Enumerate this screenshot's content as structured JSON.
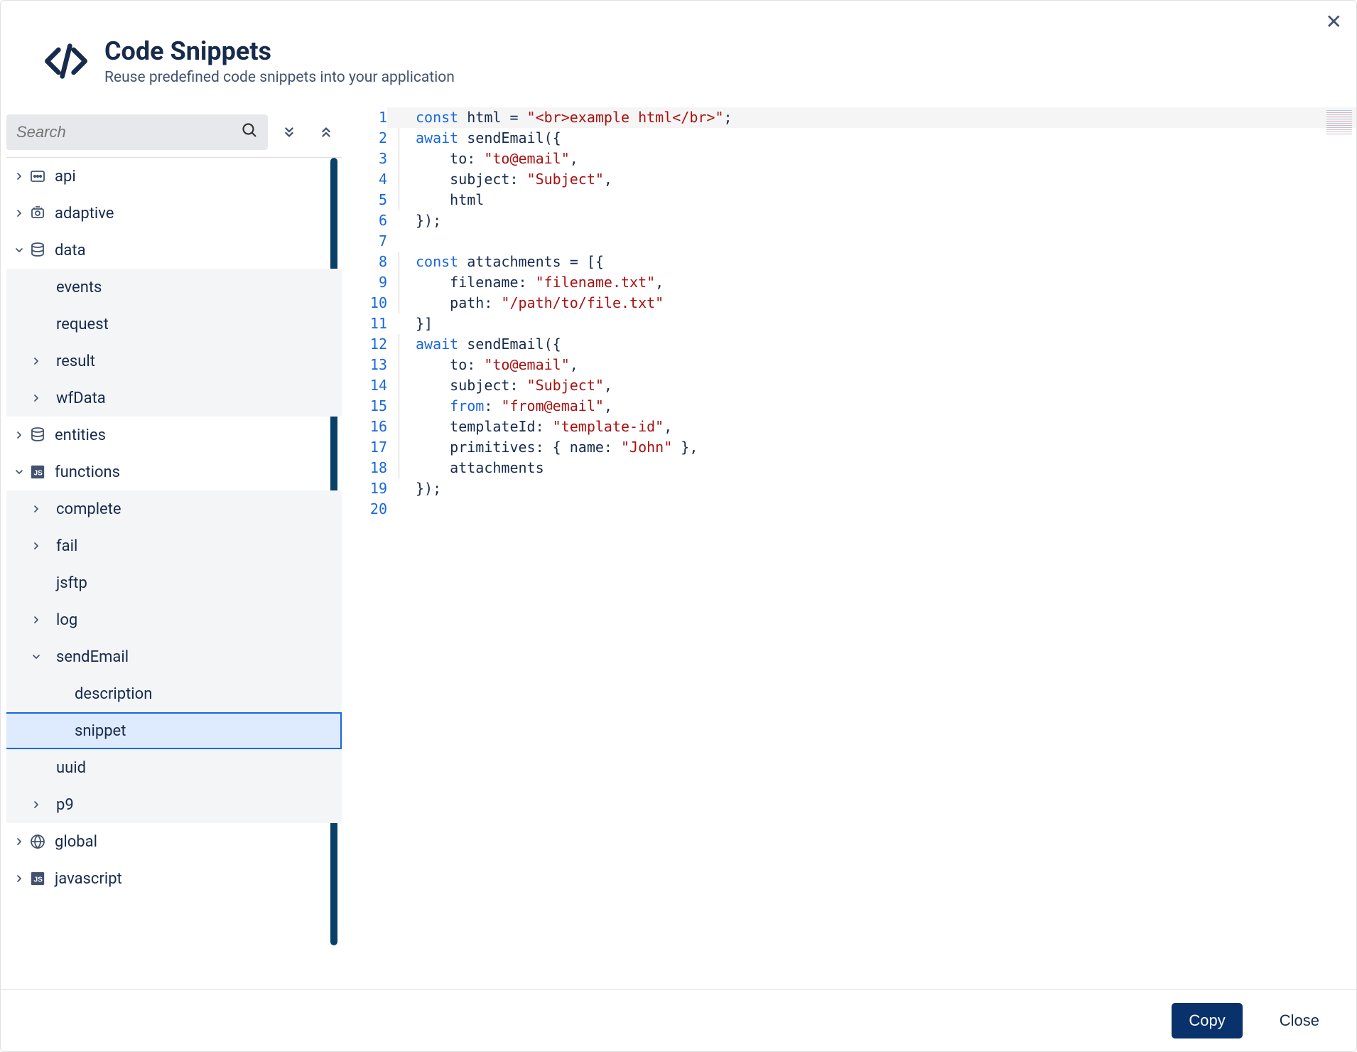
{
  "header": {
    "title": "Code Snippets",
    "subtitle": "Reuse predefined code snippets into your application"
  },
  "search": {
    "placeholder": "Search"
  },
  "tree": [
    {
      "id": "api",
      "label": "api",
      "indent": 0,
      "chevron": "right",
      "icon": "api",
      "bg": ""
    },
    {
      "id": "adaptive",
      "label": "adaptive",
      "indent": 0,
      "chevron": "right",
      "icon": "adaptive",
      "bg": ""
    },
    {
      "id": "data",
      "label": "data",
      "indent": 0,
      "chevron": "down",
      "icon": "db",
      "bg": ""
    },
    {
      "id": "events",
      "label": "events",
      "indent": 1,
      "chevron": "",
      "icon": "",
      "bg": "child"
    },
    {
      "id": "request",
      "label": "request",
      "indent": 1,
      "chevron": "",
      "icon": "",
      "bg": "child"
    },
    {
      "id": "result",
      "label": "result",
      "indent": 1,
      "chevron": "right",
      "icon": "",
      "bg": "child"
    },
    {
      "id": "wfdata",
      "label": "wfData",
      "indent": 1,
      "chevron": "right",
      "icon": "",
      "bg": "child"
    },
    {
      "id": "entities",
      "label": "entities",
      "indent": 0,
      "chevron": "right",
      "icon": "db",
      "bg": ""
    },
    {
      "id": "functions",
      "label": "functions",
      "indent": 0,
      "chevron": "down",
      "icon": "js",
      "bg": ""
    },
    {
      "id": "complete",
      "label": "complete",
      "indent": 1,
      "chevron": "right",
      "icon": "",
      "bg": "child"
    },
    {
      "id": "fail",
      "label": "fail",
      "indent": 1,
      "chevron": "right",
      "icon": "",
      "bg": "child"
    },
    {
      "id": "jsftp",
      "label": "jsftp",
      "indent": 1,
      "chevron": "",
      "icon": "",
      "bg": "child"
    },
    {
      "id": "log",
      "label": "log",
      "indent": 1,
      "chevron": "right",
      "icon": "",
      "bg": "child"
    },
    {
      "id": "sendemail",
      "label": "sendEmail",
      "indent": 1,
      "chevron": "down",
      "icon": "",
      "bg": "child"
    },
    {
      "id": "description",
      "label": "description",
      "indent": 2,
      "chevron": "",
      "icon": "",
      "bg": "child"
    },
    {
      "id": "snippet",
      "label": "snippet",
      "indent": 2,
      "chevron": "",
      "icon": "",
      "bg": "selected"
    },
    {
      "id": "uuid",
      "label": "uuid",
      "indent": 1,
      "chevron": "",
      "icon": "",
      "bg": "child"
    },
    {
      "id": "p9",
      "label": "p9",
      "indent": 1,
      "chevron": "right",
      "icon": "",
      "bg": "child"
    },
    {
      "id": "global",
      "label": "global",
      "indent": 0,
      "chevron": "right",
      "icon": "globe",
      "bg": ""
    },
    {
      "id": "javascript",
      "label": "javascript",
      "indent": 0,
      "chevron": "right",
      "icon": "js",
      "bg": ""
    }
  ],
  "code_lines": [
    [
      {
        "t": "kw",
        "v": "const"
      },
      {
        "t": "plain",
        "v": " html = "
      },
      {
        "t": "str",
        "v": "\"<br>example html</br>\""
      },
      {
        "t": "plain",
        "v": ";"
      }
    ],
    [
      {
        "t": "kw",
        "v": "await"
      },
      {
        "t": "plain",
        "v": " sendEmail({"
      }
    ],
    [
      {
        "t": "plain",
        "v": "    to: "
      },
      {
        "t": "str",
        "v": "\"to@email\""
      },
      {
        "t": "plain",
        "v": ","
      }
    ],
    [
      {
        "t": "plain",
        "v": "    subject: "
      },
      {
        "t": "str",
        "v": "\"Subject\""
      },
      {
        "t": "plain",
        "v": ","
      }
    ],
    [
      {
        "t": "plain",
        "v": "    html"
      }
    ],
    [
      {
        "t": "plain",
        "v": "});"
      }
    ],
    [],
    [
      {
        "t": "kw",
        "v": "const"
      },
      {
        "t": "plain",
        "v": " attachments = [{"
      }
    ],
    [
      {
        "t": "plain",
        "v": "    filename: "
      },
      {
        "t": "str",
        "v": "\"filename.txt\""
      },
      {
        "t": "plain",
        "v": ","
      }
    ],
    [
      {
        "t": "plain",
        "v": "    path: "
      },
      {
        "t": "str",
        "v": "\"/path/to/file.txt\""
      }
    ],
    [
      {
        "t": "plain",
        "v": "}]"
      }
    ],
    [
      {
        "t": "kw",
        "v": "await"
      },
      {
        "t": "plain",
        "v": " sendEmail({"
      }
    ],
    [
      {
        "t": "plain",
        "v": "    to: "
      },
      {
        "t": "str",
        "v": "\"to@email\""
      },
      {
        "t": "plain",
        "v": ","
      }
    ],
    [
      {
        "t": "plain",
        "v": "    subject: "
      },
      {
        "t": "str",
        "v": "\"Subject\""
      },
      {
        "t": "plain",
        "v": ","
      }
    ],
    [
      {
        "t": "plain",
        "v": "    "
      },
      {
        "t": "kw",
        "v": "from"
      },
      {
        "t": "plain",
        "v": ": "
      },
      {
        "t": "str",
        "v": "\"from@email\""
      },
      {
        "t": "plain",
        "v": ","
      }
    ],
    [
      {
        "t": "plain",
        "v": "    templateId: "
      },
      {
        "t": "str",
        "v": "\"template-id\""
      },
      {
        "t": "plain",
        "v": ","
      }
    ],
    [
      {
        "t": "plain",
        "v": "    primitives: { name: "
      },
      {
        "t": "str",
        "v": "\"John\""
      },
      {
        "t": "plain",
        "v": " },"
      }
    ],
    [
      {
        "t": "plain",
        "v": "    attachments"
      }
    ],
    [
      {
        "t": "plain",
        "v": "});"
      }
    ],
    []
  ],
  "footer": {
    "copy": "Copy",
    "close": "Close"
  }
}
